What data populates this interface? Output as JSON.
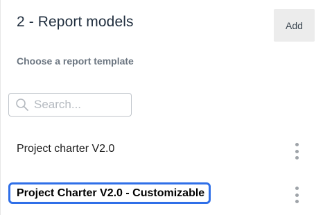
{
  "header": {
    "title": "2 - Report models",
    "add_label": "Add"
  },
  "subtitle": "Choose a report template",
  "search": {
    "placeholder": "Search...",
    "value": ""
  },
  "templates": [
    {
      "label": "Project charter V2.0",
      "selected": false
    },
    {
      "label": "Project Charter V2.0 - Customizable",
      "selected": true
    }
  ],
  "colors": {
    "focus_outline": "#2f6fe8",
    "button_bg": "#ececec"
  }
}
